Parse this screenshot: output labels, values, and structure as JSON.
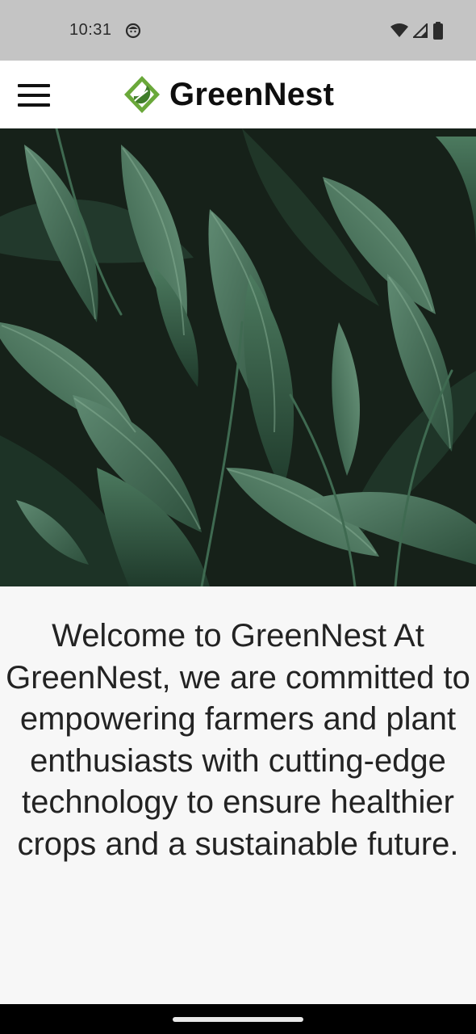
{
  "status_bar": {
    "time": "10:31",
    "icons": [
      "face-notification-icon",
      "wifi-icon",
      "cell-signal-icon",
      "battery-icon"
    ]
  },
  "app_bar": {
    "brand_name": "GreenNest",
    "menu_icon": "hamburger-menu-icon",
    "logo_icon": "leaf-diamond-logo"
  },
  "hero": {
    "image": "dark green plantain leaves photo"
  },
  "content": {
    "welcome_text": "Welcome to GreenNest At GreenNest, we are committed to empowering farmers and plant enthusiasts with cutting-edge technology to ensure healthier crops and a sustainable future."
  },
  "colors": {
    "status_bar_bg": "#c4c4c4",
    "app_bar_bg": "#ffffff",
    "page_bg": "#f7f7f7",
    "brand_green": "#6aa83a",
    "text": "#232323"
  }
}
